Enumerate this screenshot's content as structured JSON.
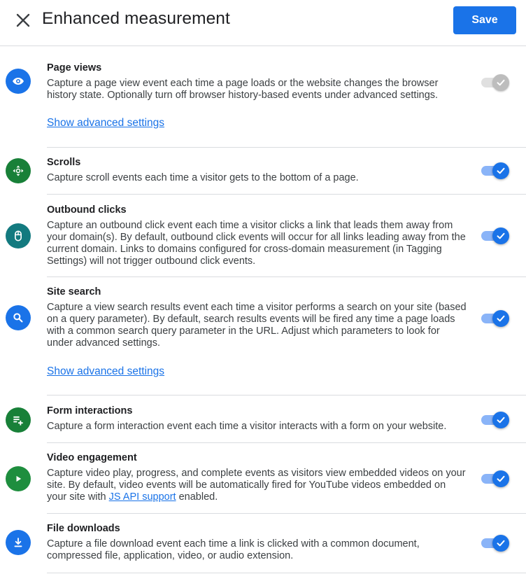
{
  "header": {
    "title": "Enhanced measurement",
    "save_label": "Save",
    "close_icon": "close-icon"
  },
  "colors": {
    "accent": "#1a73e8",
    "track": "#8ab4f8",
    "disabled": "#bdbdbd"
  },
  "items": [
    {
      "title": "Page views",
      "desc": "Capture a page view event each time a page loads or the website changes the browser history state. Optionally turn off browser history-based events under advanced settings.",
      "advanced": "Show advanced settings",
      "icon": "eye-icon",
      "enabled": true,
      "disabled": true
    },
    {
      "title": "Scrolls",
      "desc": "Capture scroll events each time a visitor gets to the bottom of a page.",
      "icon": "scroll-arrows-icon",
      "enabled": true
    },
    {
      "title": "Outbound clicks",
      "desc": "Capture an outbound click event each time a visitor clicks a link that leads them away from your domain(s). By default, outbound click events will occur for all links leading away from the current domain. Links to domains configured for cross-domain measurement (in Tagging Settings) will not trigger outbound click events.",
      "icon": "mouse-icon",
      "enabled": true
    },
    {
      "title": "Site search",
      "desc": "Capture a view search results event each time a visitor performs a search on your site (based on a query parameter). By default, search results events will be fired any time a page loads with a common search query parameter in the URL. Adjust which parameters to look for under advanced settings.",
      "advanced": "Show advanced settings",
      "icon": "search-icon",
      "enabled": true
    },
    {
      "title": "Form interactions",
      "desc": "Capture a form interaction event each time a visitor interacts with a form on your website.",
      "icon": "playlist-add-icon",
      "enabled": true
    },
    {
      "title": "Video engagement",
      "desc_before": "Capture video play, progress, and complete events as visitors view embedded videos on your site. By default, video events will be automatically fired for YouTube videos embedded on your site with ",
      "desc_link": "JS API support",
      "desc_after": " enabled.",
      "icon": "play-icon",
      "enabled": true
    },
    {
      "title": "File downloads",
      "desc": "Capture a file download event each time a link is clicked with a common document, compressed file, application, video, or audio extension.",
      "icon": "download-icon",
      "enabled": true
    }
  ]
}
